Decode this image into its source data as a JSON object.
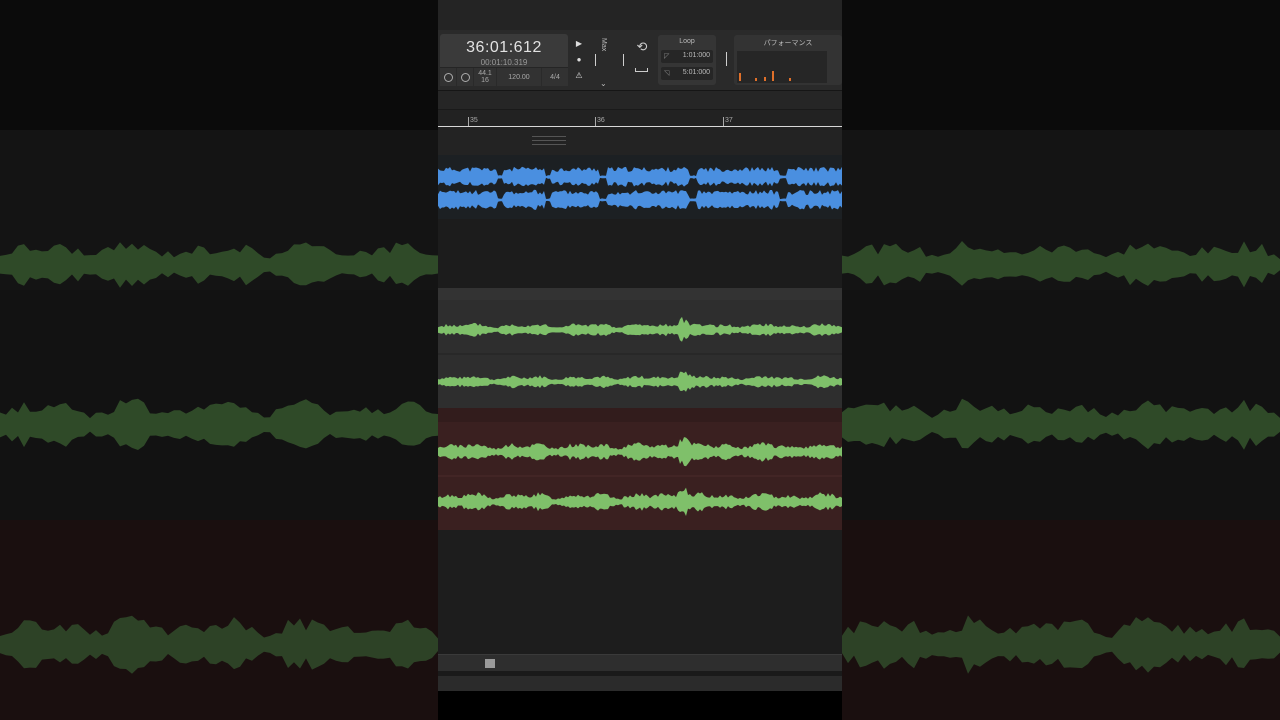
{
  "transport": {
    "time_main": "36:01:612",
    "time_sub": "00:01:10.319",
    "sample_rate_top": "44.1",
    "sample_rate_bottom": "16",
    "tempo": "120.00",
    "time_signature": "4/4",
    "max_label": "Max"
  },
  "loop": {
    "title": "Loop",
    "start": "1:01:000",
    "end": "5:01:000"
  },
  "performance": {
    "title": "パフォーマンス",
    "bars": [
      0.3,
      0.1,
      0.15,
      0.35,
      0.1
    ]
  },
  "ruler": {
    "marks": [
      "35",
      "36",
      "37"
    ]
  },
  "colors": {
    "audio_blue": "#4a8fe0",
    "audio_green": "#7fc06a",
    "accent_orange": "#e0702a",
    "record_track_bg": "#3a2020"
  },
  "icons": {
    "play": "▶",
    "record": "●",
    "metronome": "⚠",
    "loop": "⟲",
    "chevron": "⌄"
  }
}
